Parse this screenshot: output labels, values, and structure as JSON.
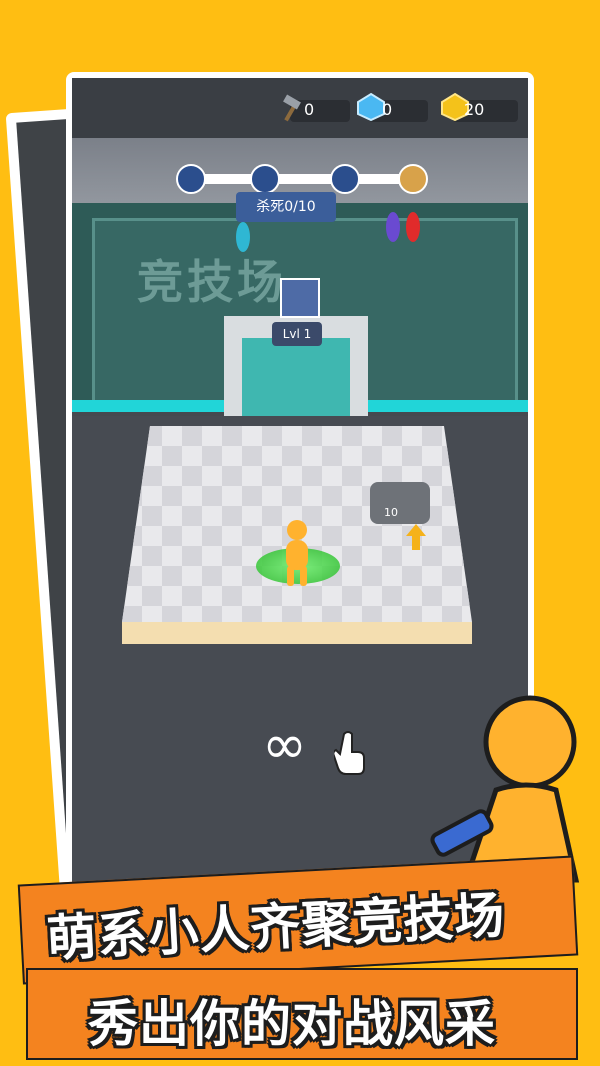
{
  "hud": {
    "hammers": "0",
    "diamonds": "0",
    "gold": "20"
  },
  "arena": {
    "floor_label": "竞技场",
    "kill_counter": "杀死0/10",
    "level_badge": "Lvl 1",
    "upgrade_cost": "10"
  },
  "hint": {
    "gesture": "∞"
  },
  "promo": {
    "line1": "萌系小人齐聚竞技场",
    "line2": "秀出你的对战风采"
  },
  "colors": {
    "background": "#FFBE12",
    "banner": "#F4831F",
    "player": "#FFB22E",
    "accent_cyan": "#21D5D8"
  },
  "icons": [
    "hammer-icon",
    "diamond-icon",
    "gold-bar-icon",
    "sword-icon",
    "helmet-icon",
    "infinity-swipe-icon",
    "pointing-hand-icon"
  ]
}
